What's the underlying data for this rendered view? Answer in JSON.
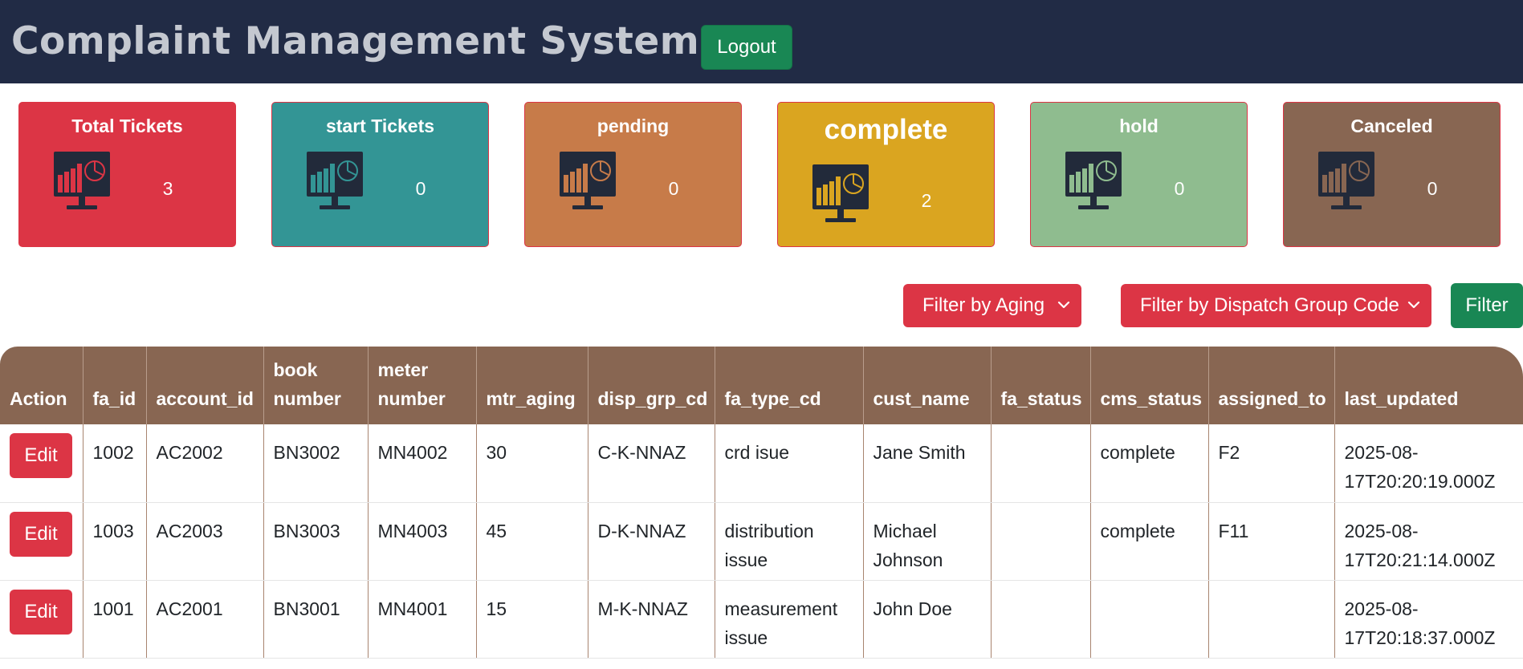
{
  "header": {
    "title": "Complaint Management System",
    "logout_label": "Logout"
  },
  "cards": [
    {
      "title": "Total Tickets",
      "count": "3",
      "color": "#dc3545",
      "icon_color": "#dc3545"
    },
    {
      "title": "start Tickets",
      "count": "0",
      "color": "#339595",
      "icon_color": "#339595"
    },
    {
      "title": "pending",
      "count": "0",
      "color": "#c77b49",
      "icon_color": "#c77b49"
    },
    {
      "title": "complete",
      "count": "2",
      "color": "#daa520",
      "icon_color": "#daa520"
    },
    {
      "title": "hold",
      "count": "0",
      "color": "#8fbc8f",
      "icon_color": "#8fbc8f"
    },
    {
      "title": "Canceled",
      "count": "0",
      "color": "#886652",
      "icon_color": "#886652"
    }
  ],
  "filters": {
    "aging_label": "Filter by Aging",
    "dispatch_label": "Filter by Dispatch Group Code",
    "filter_button": "Filter"
  },
  "table": {
    "columns": {
      "action": "Action",
      "fa_id": "fa_id",
      "account_id": "account_id",
      "book_number": "book number",
      "meter_number": "meter number",
      "mtr_aging": "mtr_aging",
      "disp_grp_cd": "disp_grp_cd",
      "fa_type_cd": "fa_type_cd",
      "cust_name": "cust_name",
      "fa_status": "fa_status",
      "cms_status": "cms_status",
      "assigned_to": "assigned_to",
      "last_updated": "last_updated"
    },
    "edit_label": "Edit",
    "rows": [
      {
        "fa_id": "1002",
        "account_id": "AC2002",
        "book_number": "BN3002",
        "meter_number": "MN4002",
        "mtr_aging": "30",
        "disp_grp_cd": "C-K-NNAZ",
        "fa_type_cd": "crd isue",
        "cust_name": "Jane Smith",
        "fa_status": "",
        "cms_status": "complete",
        "assigned_to": "F2",
        "last_updated": "2025-08-17T20:20:19.000Z"
      },
      {
        "fa_id": "1003",
        "account_id": "AC2003",
        "book_number": "BN3003",
        "meter_number": "MN4003",
        "mtr_aging": "45",
        "disp_grp_cd": "D-K-NNAZ",
        "fa_type_cd": "distribution issue",
        "cust_name": "Michael Johnson",
        "fa_status": "",
        "cms_status": "complete",
        "assigned_to": "F11",
        "last_updated": "2025-08-17T20:21:14.000Z"
      },
      {
        "fa_id": "1001",
        "account_id": "AC2001",
        "book_number": "BN3001",
        "meter_number": "MN4001",
        "mtr_aging": "15",
        "disp_grp_cd": "M-K-NNAZ",
        "fa_type_cd": "measurement issue",
        "cust_name": "John Doe",
        "fa_status": "",
        "cms_status": "",
        "assigned_to": "",
        "last_updated": "2025-08-17T20:18:37.000Z"
      }
    ]
  }
}
